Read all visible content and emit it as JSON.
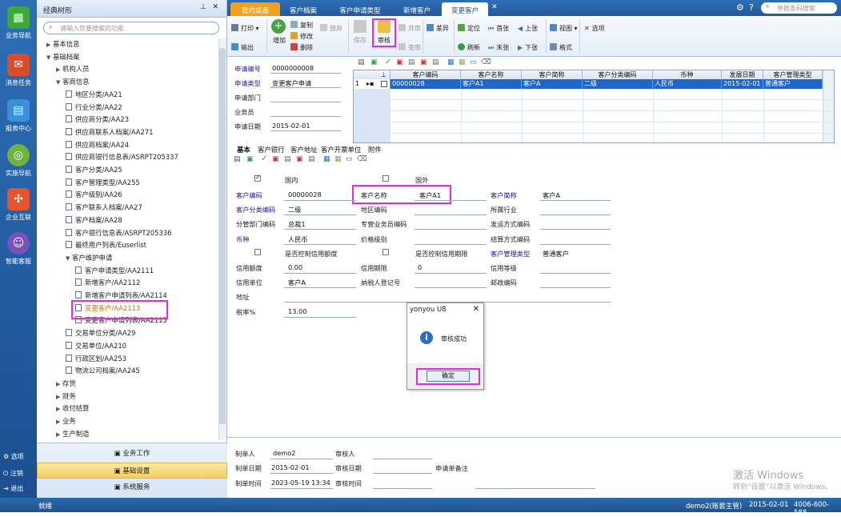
{
  "rail": {
    "items": [
      {
        "label": "业务导航",
        "color": "#3fa83a"
      },
      {
        "label": "消息任务",
        "color": "#d94d2d"
      },
      {
        "label": "报表中心",
        "color": "#3b8ed8"
      },
      {
        "label": "实施导航",
        "color": "#6db33f"
      },
      {
        "label": "企业互联",
        "color": "#e2552f"
      },
      {
        "label": "智能客服",
        "color": "#7a4fc0"
      }
    ],
    "bottom": [
      "选项",
      "注销",
      "退出"
    ]
  },
  "tree": {
    "title": "经典树形",
    "search_placeholder": "请输入您要搜索的功能",
    "nodes": [
      {
        "label": "基本信息",
        "level": 1,
        "type": "collapsed"
      },
      {
        "label": "基础档案",
        "level": 1,
        "type": "expanded"
      },
      {
        "label": "机构人员",
        "level": 2,
        "type": "collapsed"
      },
      {
        "label": "客商信息",
        "level": 2,
        "type": "expanded"
      },
      {
        "label": "地区分类/AA21",
        "level": 3,
        "type": "doc"
      },
      {
        "label": "行业分类/AA22",
        "level": 3,
        "type": "doc"
      },
      {
        "label": "供应商分类/AA23",
        "level": 3,
        "type": "doc"
      },
      {
        "label": "供应商联系人档案/AA271",
        "level": 3,
        "type": "doc"
      },
      {
        "label": "供应商档案/AA24",
        "level": 3,
        "type": "doc"
      },
      {
        "label": "供应商银行信息表/ASRPT205337",
        "level": 3,
        "type": "doc"
      },
      {
        "label": "客户分类/AA25",
        "level": 3,
        "type": "doc"
      },
      {
        "label": "客户管理类型/AA255",
        "level": 3,
        "type": "doc"
      },
      {
        "label": "客户级别/AA26",
        "level": 3,
        "type": "doc"
      },
      {
        "label": "客户联系人档案/AA27",
        "level": 3,
        "type": "doc"
      },
      {
        "label": "客户档案/AA28",
        "level": 3,
        "type": "doc"
      },
      {
        "label": "客户银行信息表/ASRPT205336",
        "level": 3,
        "type": "doc"
      },
      {
        "label": "最终用户列表/Euserlist",
        "level": 3,
        "type": "doc"
      },
      {
        "label": "客户维护申请",
        "level": 3,
        "type": "expanded"
      },
      {
        "label": "客户申请类型/AA2111",
        "level": 4,
        "type": "doc"
      },
      {
        "label": "新增客户/AA2112",
        "level": 4,
        "type": "doc"
      },
      {
        "label": "新增客户申请列表/AA2114",
        "level": 4,
        "type": "doc"
      },
      {
        "label": "变更客户/AA2113",
        "level": 4,
        "type": "doc",
        "active": true
      },
      {
        "label": "变更客户申请列表/AA2115",
        "level": 4,
        "type": "doc"
      },
      {
        "label": "交易单位分类/AA29",
        "level": 3,
        "type": "doc"
      },
      {
        "label": "交易单位/AA210",
        "level": 3,
        "type": "doc"
      },
      {
        "label": "行政区划/AA253",
        "level": 3,
        "type": "doc"
      },
      {
        "label": "物流公司档案/AA245",
        "level": 3,
        "type": "doc"
      },
      {
        "label": "存货",
        "level": 2,
        "type": "collapsed"
      },
      {
        "label": "财务",
        "level": 2,
        "type": "collapsed"
      },
      {
        "label": "收付结算",
        "level": 2,
        "type": "collapsed"
      },
      {
        "label": "业务",
        "level": 2,
        "type": "collapsed"
      },
      {
        "label": "生产制造",
        "level": 2,
        "type": "collapsed"
      }
    ],
    "bottom_buttons": [
      "业务工作",
      "基础设置",
      "系统服务"
    ]
  },
  "tabs": [
    "我的桌面",
    "客户档案",
    "客户申请类型",
    "新增客户",
    "变更客户"
  ],
  "search": {
    "placeholder": "单据条码搜索"
  },
  "toolbar": {
    "print": "打印",
    "export": "输出",
    "add": "增加",
    "copy": "复制",
    "edit": "修改",
    "delete": "删除",
    "abandon": "放弃",
    "save": "保存",
    "audit": "审核",
    "reject": "弃审",
    "query": "查审",
    "diff": "差异",
    "locate": "定位",
    "refresh": "刷新",
    "first": "首张",
    "last": "末张",
    "prev": "上张",
    "next": "下张",
    "view": "视图",
    "format": "格式",
    "options": "选项"
  },
  "header_fields": {
    "req_no_label": "申请编号",
    "req_no": "0000000008",
    "req_type_label": "申请类型",
    "req_type": "变更客户申请",
    "dept_label": "申请部门",
    "dept": "",
    "staff_label": "业务员",
    "staff": "",
    "date_label": "申请日期",
    "date": "2015-02-01"
  },
  "grid": {
    "columns": [
      "客户编码",
      "客户名称",
      "客户简称",
      "客户分类编码",
      "币种",
      "发展日期",
      "客户管理类型"
    ],
    "rows": [
      {
        "index": "1",
        "cells": [
          "00000028",
          "客户A1",
          "客户A",
          "二级",
          "人民币",
          "2015-02-01",
          "普通客户"
        ]
      }
    ]
  },
  "subtabs": [
    "基本",
    "客户银行",
    "客户地址",
    "客户开票单位",
    "附件"
  ],
  "detail": {
    "domestic": "国内",
    "foreign": "国外",
    "cust_code_label": "客户编码",
    "cust_code": "00000028",
    "cust_name_label": "客户名称",
    "cust_name": "客户A1",
    "cust_abbr_label": "客户简称",
    "cust_abbr": "客户A",
    "cust_class_label": "客户分类编码",
    "cust_class": "二级",
    "region_label": "地区编码",
    "region": "",
    "industry_label": "所属行业",
    "industry": "",
    "dept_label": "分管部门编码",
    "dept": "总裁1",
    "sales_label": "专营业务员编码",
    "sales": "",
    "ship_label": "发运方式编码",
    "ship": "",
    "currency_label": "币种",
    "currency": "人民币",
    "price_label": "价格级别",
    "price": "",
    "settle_label": "结算方式编码",
    "settle": "",
    "ctrl_credit": "是否控制信用额度",
    "ctrl_period": "是否控制信用期限",
    "mgmt_type_label": "客户管理类型",
    "mgmt_type": "普通客户",
    "credit_amt_label": "信用额度",
    "credit_amt": "0.00",
    "credit_period_label": "信用期限",
    "credit_period": "0",
    "credit_level_label": "信用等级",
    "credit_level": "",
    "credit_unit_label": "信用单位",
    "credit_unit": "客户A",
    "tax_id_label": "纳税人登记号",
    "tax_id": "",
    "zip_label": "邮政编码",
    "zip": "",
    "address_label": "地址",
    "address": "",
    "tax_rate_label": "税率%",
    "tax_rate": "13.00"
  },
  "dialog": {
    "title": "yonyou U8",
    "message": "审核成功",
    "ok": "确定"
  },
  "footer": {
    "maker_label": "制单人",
    "maker": "demo2",
    "auditor_label": "审核人",
    "auditor": "",
    "make_date_label": "制单日期",
    "make_date": "2015-02-01",
    "audit_date_label": "审核日期",
    "audit_date": "",
    "remark_label": "申请单备注",
    "make_time_label": "制单时间",
    "make_time": "2023-05-19  13:34",
    "audit_time_label": "审核时间",
    "audit_time": ""
  },
  "status": {
    "left": "就绪",
    "user": "demo2(账套主管)",
    "date": "2015-02-01",
    "phone": "4006-600-588"
  },
  "watermark": {
    "line1": "激活 Windows",
    "line2": "转到“设置”以激活 Windows。"
  }
}
